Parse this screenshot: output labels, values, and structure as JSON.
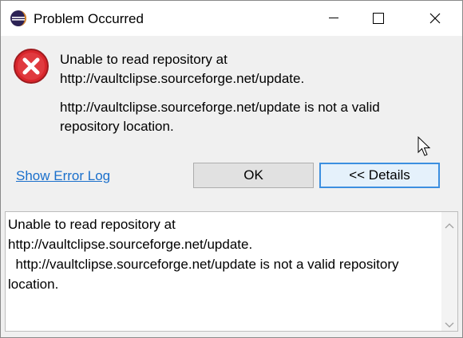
{
  "window": {
    "title": "Problem Occurred"
  },
  "icons": {
    "app": "eclipse-icon",
    "message": "error-icon",
    "minimize": "minimize-icon",
    "maximize": "maximize-icon",
    "close": "close-icon",
    "cursor": "mouse-cursor-icon"
  },
  "message": {
    "line1": "Unable to read repository at",
    "line2": "http://vaultclipse.sourceforge.net/update.",
    "detail": "http://vaultclipse.sourceforge.net/update is not a valid repository location."
  },
  "actions": {
    "show_error_log": "Show Error Log",
    "ok": "OK",
    "details": "<< Details"
  },
  "details_text": "Unable to read repository at\nhttp://vaultclipse.sourceforge.net/update.\n  http://vaultclipse.sourceforge.net/update is not a valid repository location.",
  "colors": {
    "link": "#1a6fcb",
    "error_red": "#d9262c",
    "focus_border": "#3c8fe0"
  }
}
